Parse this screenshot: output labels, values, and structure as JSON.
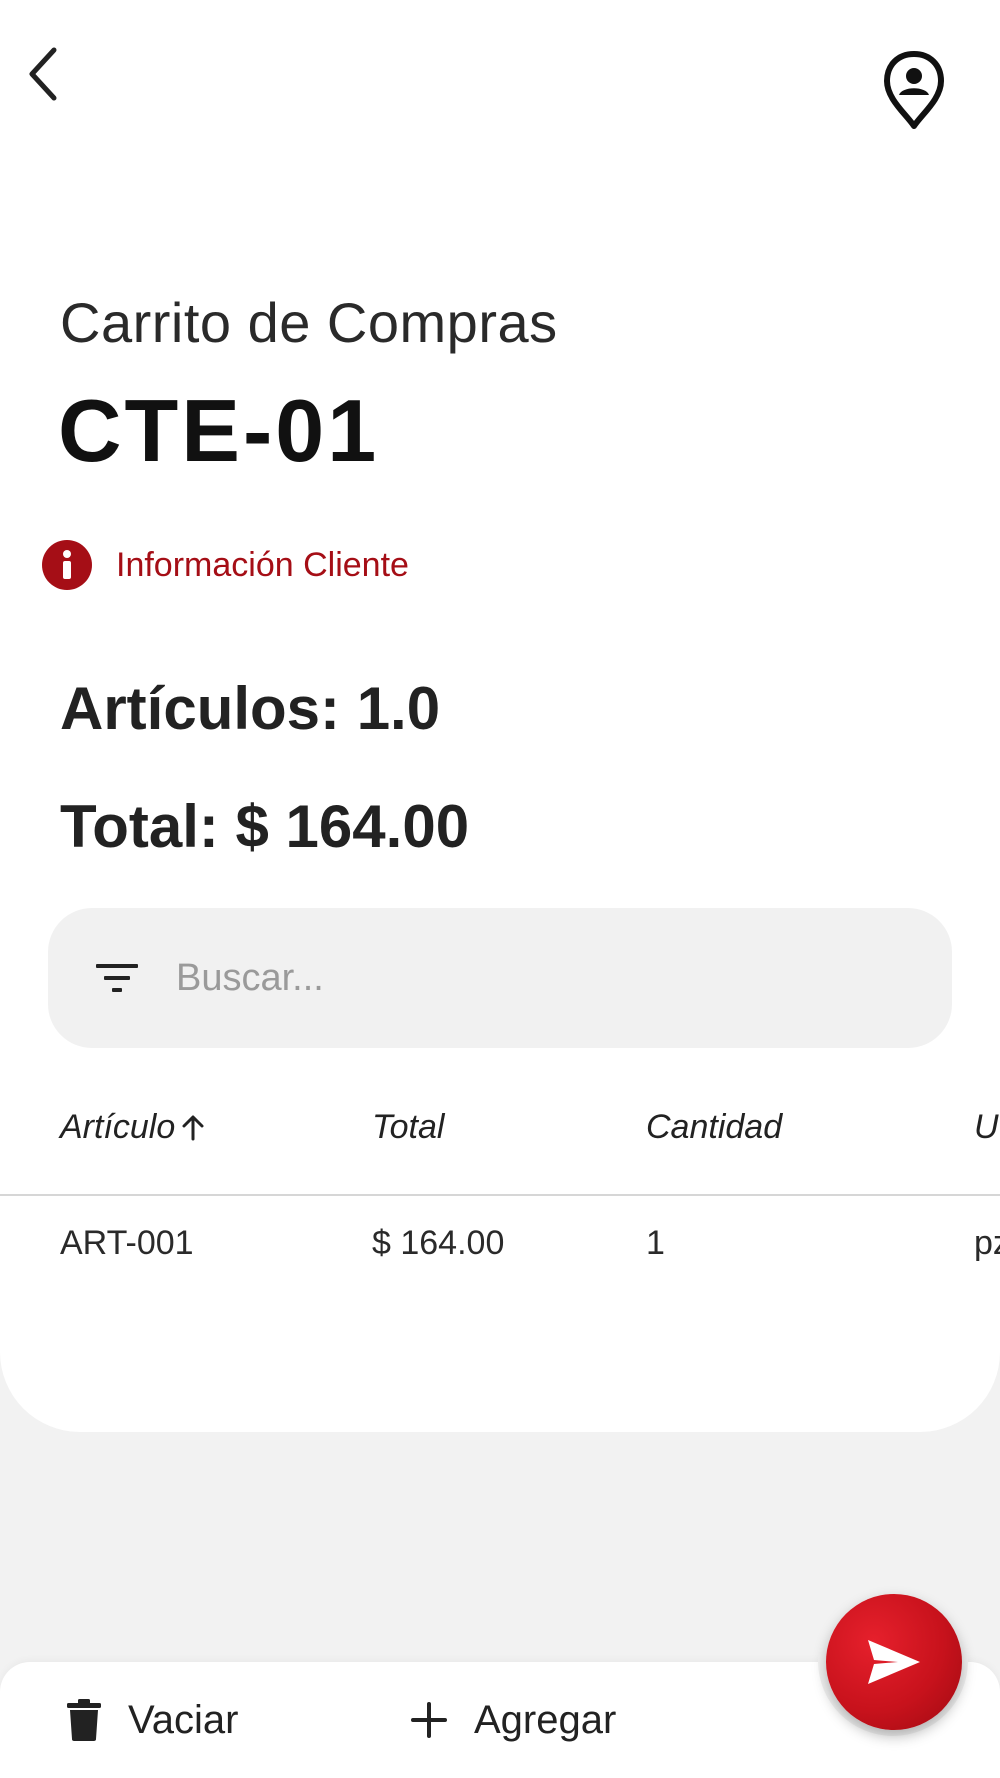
{
  "header": {
    "back_icon": "chevron-left-icon",
    "location_icon": "person-pin-icon"
  },
  "page": {
    "subtitle": "Carrito de Compras",
    "code": "CTE-01",
    "client_info_label": "Información Cliente",
    "items_text": "Artículos: 1.0",
    "total_text": "Total: $ 164.00"
  },
  "search": {
    "placeholder": "Buscar...",
    "value": ""
  },
  "table": {
    "columns": [
      "Artículo",
      "Total",
      "Cantidad",
      "U"
    ],
    "sort_indicator": "arrow-up-icon",
    "rows": [
      {
        "articulo": "ART-001",
        "total": "$ 164.00",
        "cantidad": "1",
        "unidad": "pz"
      }
    ]
  },
  "bottom_bar": {
    "clear_label": "Vaciar",
    "add_label": "Agregar",
    "send_icon": "send-icon"
  },
  "colors": {
    "accent": "#a50e16",
    "fab": "#d3141e",
    "background": "#f2f2f2"
  }
}
